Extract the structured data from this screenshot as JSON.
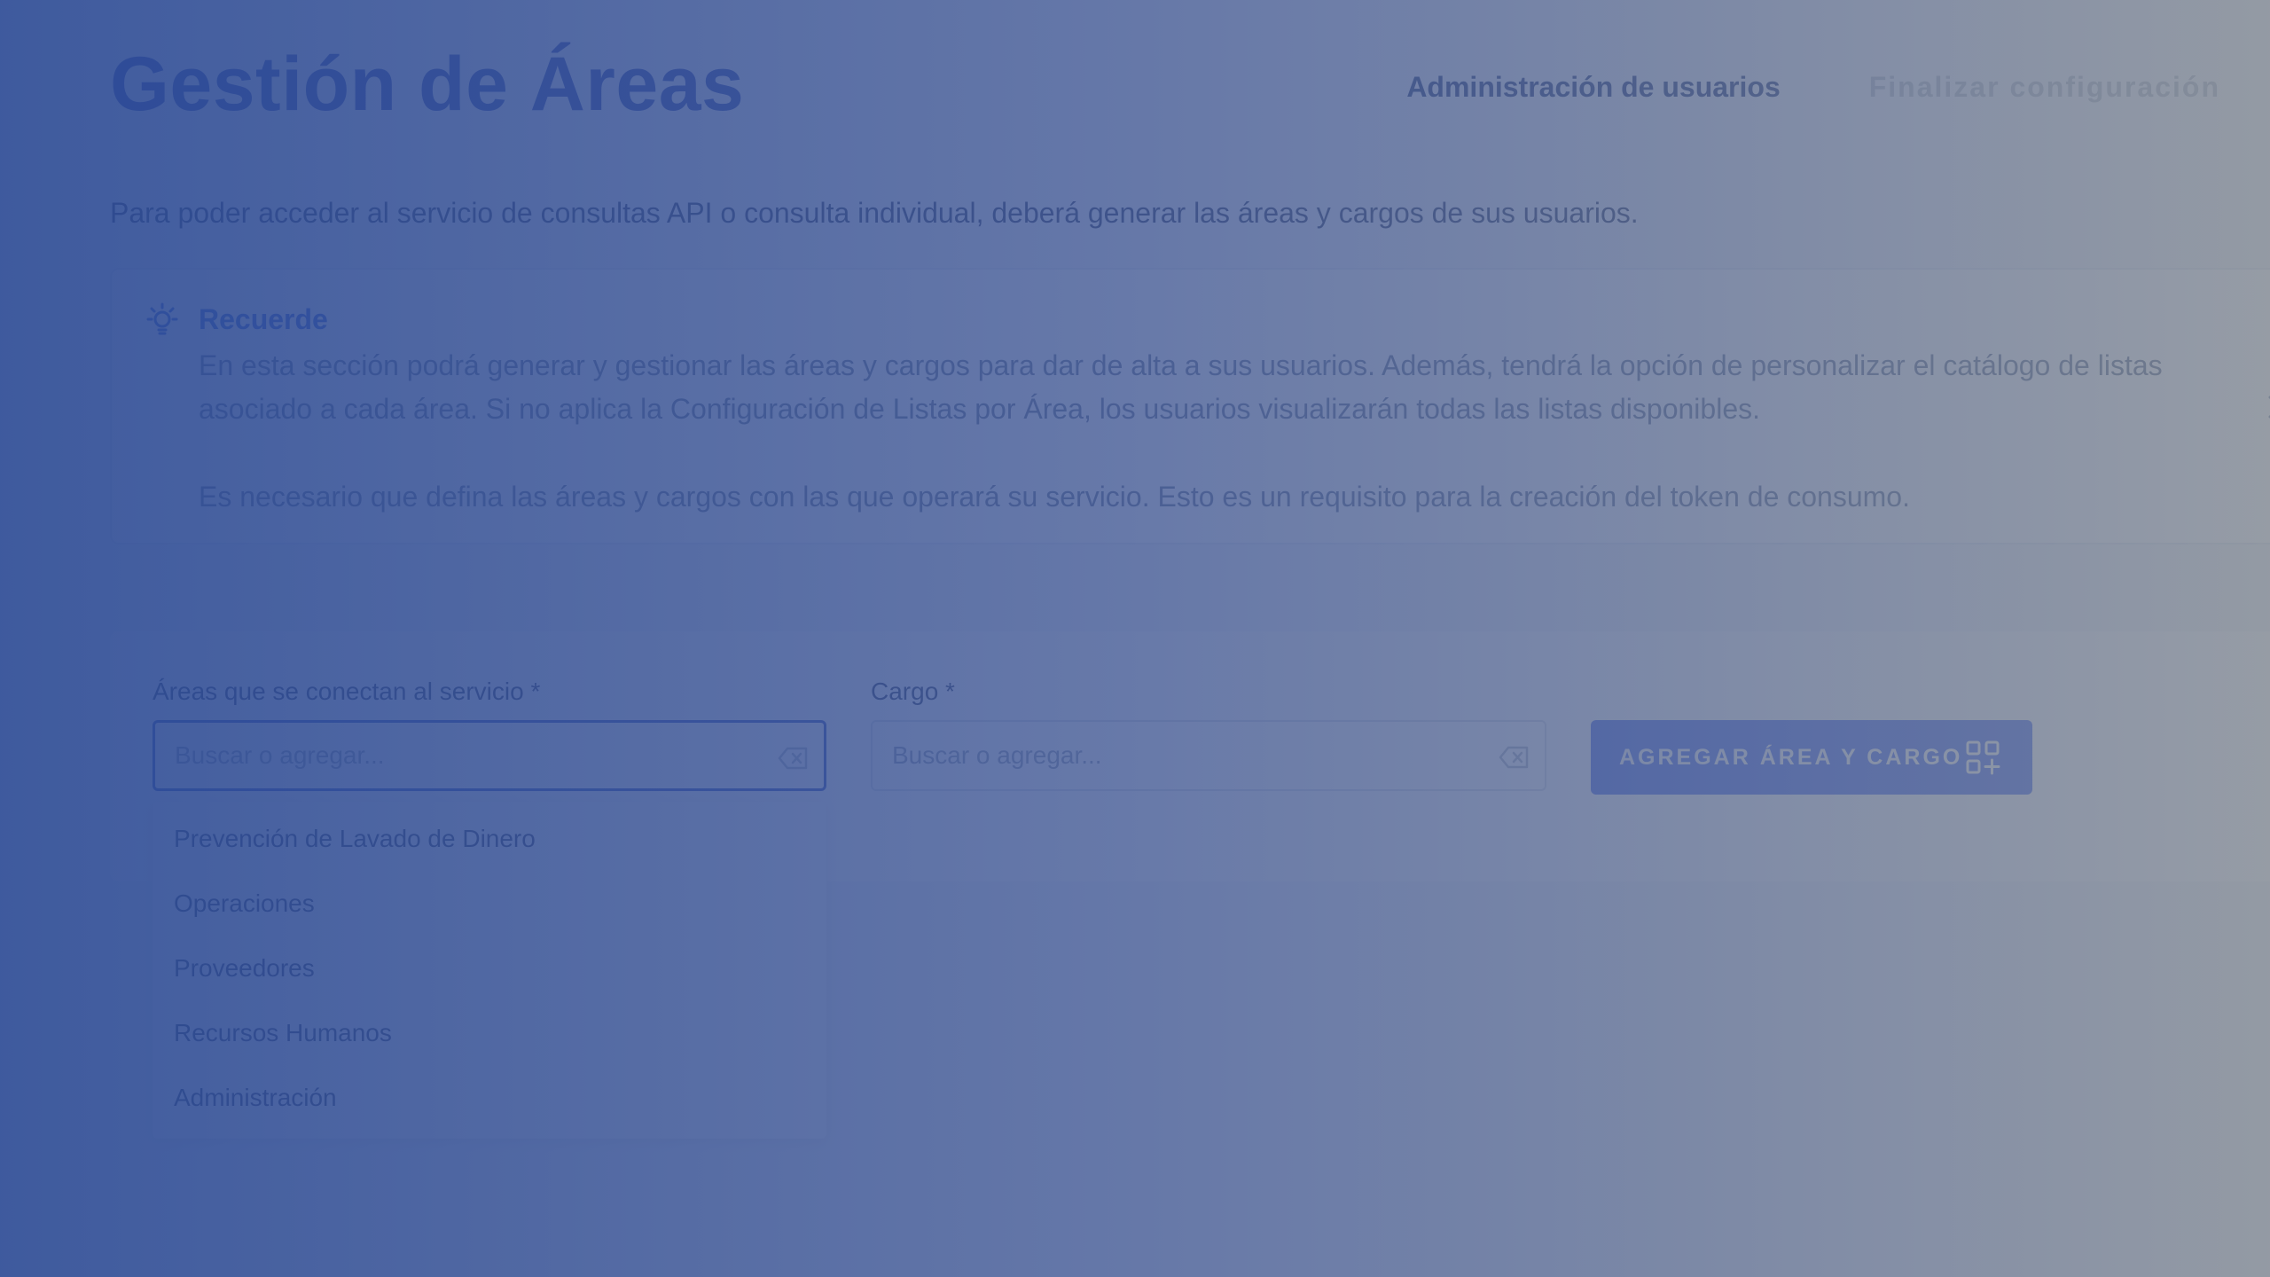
{
  "header": {
    "title": "Gestión de Áreas",
    "nav": {
      "user_admin": "Administración de usuarios",
      "finish_config": "Finalizar configuración"
    }
  },
  "intro": "Para poder acceder al servicio de consultas API o consulta individual, deberá generar las áreas y cargos de sus usuarios.",
  "info": {
    "icon": "lightbulb-icon",
    "heading": "Recuerde",
    "paragraph1": "En esta sección podrá generar y gestionar las áreas y cargos para dar de alta a sus usuarios. Además, tendrá la opción de personalizar el catálogo de listas asociado a cada área. Si no aplica la Configuración de Listas por Área, los usuarios visualizarán todas las listas disponibles.",
    "paragraph2": "Es necesario que defina las áreas y cargos con las que operará su servicio. Esto es un requisito para la creación del token de consumo."
  },
  "form": {
    "area": {
      "label": "Áreas que se conectan al servicio *",
      "placeholder": "Buscar o agregar...",
      "value": ""
    },
    "cargo": {
      "label": "Cargo *",
      "placeholder": "Buscar o agregar...",
      "value": ""
    },
    "add_button_label": "AGREGAR ÁREA Y CARGO",
    "add_button_icon": "grid-plus-icon"
  },
  "dropdown": {
    "options": [
      "Prevención de Lavado de Dinero",
      "Operaciones",
      "Proveedores",
      "Recursos Humanos",
      "Administración"
    ]
  },
  "colors": {
    "title": "#1a36a8",
    "accent_button": "#3d62f0",
    "info_heading": "#1e4fd8",
    "focus_border": "#1d3fb8"
  }
}
